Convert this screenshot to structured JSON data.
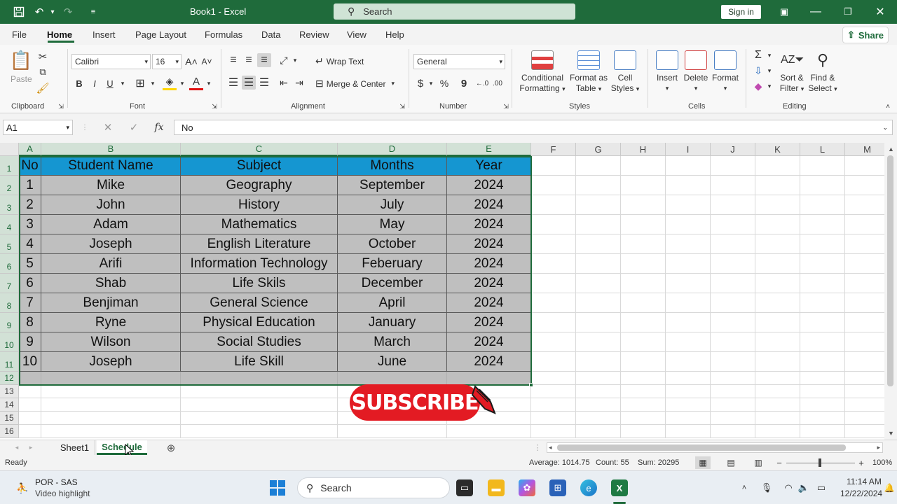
{
  "titlebar": {
    "title": "Book1  -  Excel",
    "search_placeholder": "Search",
    "signin_label": "Sign in"
  },
  "menu": {
    "tabs": [
      "File",
      "Home",
      "Insert",
      "Page Layout",
      "Formulas",
      "Data",
      "Review",
      "View",
      "Help"
    ],
    "active": "Home",
    "share_label": "Share"
  },
  "ribbon": {
    "clipboard": {
      "paste": "Paste",
      "label": "Clipboard"
    },
    "font": {
      "name": "Calibri",
      "size": "16",
      "label": "Font",
      "bold": "B",
      "italic": "I",
      "underline": "U"
    },
    "alignment": {
      "wrap": "Wrap Text",
      "merge": "Merge & Center",
      "label": "Alignment"
    },
    "number": {
      "format": "General",
      "label": "Number",
      "currency": "$",
      "percent": "%",
      "comma": "9"
    },
    "styles": {
      "conditional": [
        "Conditional",
        "Formatting"
      ],
      "format_table": [
        "Format as",
        "Table"
      ],
      "cell_styles": [
        "Cell",
        "Styles"
      ],
      "label": "Styles"
    },
    "cells": {
      "insert": "Insert",
      "delete": "Delete",
      "format": "Format",
      "label": "Cells"
    },
    "editing": {
      "sort": [
        "Sort &",
        "Filter"
      ],
      "find": [
        "Find &",
        "Select"
      ],
      "label": "Editing"
    }
  },
  "formula_bar": {
    "name_box": "A1",
    "fx": "fx",
    "value": "No"
  },
  "grid": {
    "columns": [
      "A",
      "B",
      "C",
      "D",
      "E",
      "F",
      "G",
      "H",
      "I",
      "J",
      "K",
      "L",
      "M"
    ],
    "rows": [
      "1",
      "2",
      "3",
      "4",
      "5",
      "6",
      "7",
      "8",
      "9",
      "10",
      "11",
      "12",
      "13",
      "14",
      "15",
      "16"
    ],
    "headers": [
      "No",
      "Student Name",
      "Subject",
      "Months",
      "Year"
    ],
    "data": [
      [
        "1",
        "Mike",
        "Geography",
        "September",
        "2024"
      ],
      [
        "2",
        "John",
        "History",
        "July",
        "2024"
      ],
      [
        "3",
        "Adam",
        "Mathematics",
        "May",
        "2024"
      ],
      [
        "4",
        "Joseph",
        "English Literature",
        "October",
        "2024"
      ],
      [
        "5",
        "Arifi",
        "Information Technology",
        "Feberuary",
        "2024"
      ],
      [
        "6",
        "Shab",
        "Life Skils",
        "December",
        "2024"
      ],
      [
        "7",
        "Benjiman",
        "General Science",
        "April",
        "2024"
      ],
      [
        "8",
        "Ryne",
        "Physical Education",
        "January",
        "2024"
      ],
      [
        "9",
        "Wilson",
        "Social Studies",
        "March",
        "2024"
      ],
      [
        "10",
        "Joseph",
        "Life Skill",
        "June",
        "2024"
      ]
    ],
    "header_color": "#1596d1",
    "table_color": "#bfbfbf"
  },
  "overlay": {
    "subscribe": "SUBSCRIBE"
  },
  "sheets": {
    "tabs": [
      "Sheet1",
      "Schedule"
    ],
    "active": "Schedule"
  },
  "status": {
    "ready": "Ready",
    "average": "Average: 1014.75",
    "count": "Count: 55",
    "sum": "Sum: 20295",
    "zoom": "100%"
  },
  "taskbar": {
    "widget_title": "POR - SAS",
    "widget_sub": "Video highlight",
    "search": "Search",
    "time": "11:14 AM",
    "date": "12/22/2024"
  }
}
